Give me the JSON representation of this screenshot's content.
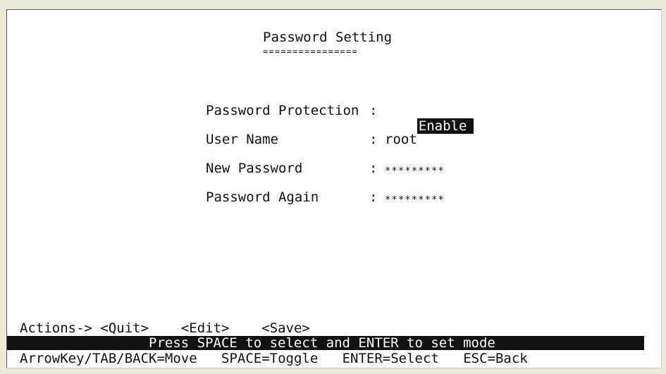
{
  "screen": {
    "title": "Password Setting",
    "title_underline": "================"
  },
  "fields": [
    {
      "label": "Password Protection",
      "separator": ":",
      "value": "Enable",
      "selected": true
    },
    {
      "label": "User Name",
      "separator": ":",
      "value": "root"
    },
    {
      "label": "New Password",
      "separator": ":",
      "value": "*********"
    },
    {
      "label": "Password Again",
      "separator": ":",
      "value": "*********"
    }
  ],
  "actions": {
    "prefix": "Actions->",
    "quit": "<Quit>",
    "edit": "<Edit>",
    "save": "<Save>"
  },
  "hint": "Press SPACE to select and ENTER to set mode",
  "keys": {
    "move": "ArrowKey/TAB/BACK=Move",
    "toggle": "SPACE=Toggle",
    "select": "ENTER=Select",
    "back": "ESC=Back"
  },
  "colors": {
    "background": "#ffffff",
    "text": "#111111",
    "highlight_bg": "#111111",
    "highlight_fg": "#ffffff",
    "window_chrome": "#ece9d8"
  }
}
